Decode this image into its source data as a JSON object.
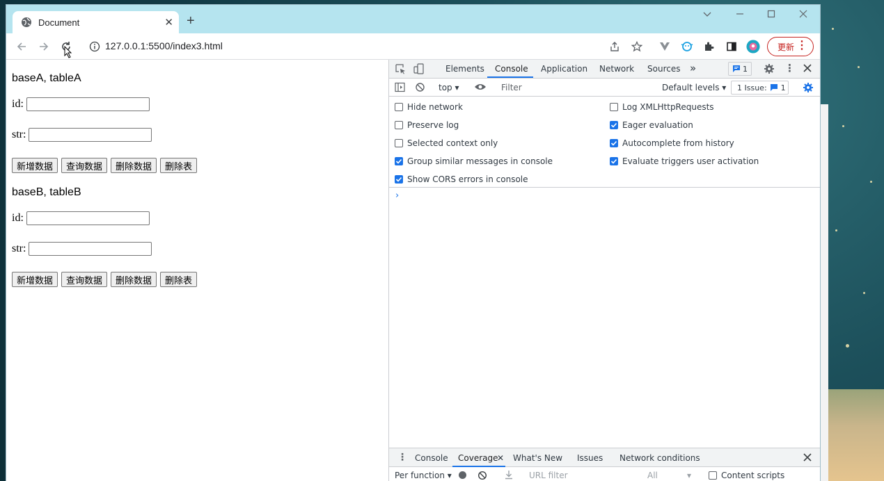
{
  "browser": {
    "tab_title": "Document",
    "url": "127.0.0.1:5500/index3.html",
    "update_label": "更新"
  },
  "page": {
    "sections": [
      {
        "heading": "baseA, tableA",
        "id_label": "id:",
        "str_label": "str:",
        "buttons": [
          "新增数据",
          "查询数据",
          "删除数据",
          "删除表"
        ]
      },
      {
        "heading": "baseB, tableB",
        "id_label": "id:",
        "str_label": "str:",
        "buttons": [
          "新增数据",
          "查询数据",
          "删除数据",
          "删除表"
        ]
      }
    ]
  },
  "devtools": {
    "tabs": [
      "Elements",
      "Console",
      "Application",
      "Network",
      "Sources"
    ],
    "active_tab": "Console",
    "messages_badge": "1",
    "toolbar": {
      "context": "top",
      "filter_placeholder": "Filter",
      "levels": "Default levels",
      "issues_label": "1 Issue:",
      "issues_count": "1"
    },
    "settings_left": [
      {
        "label": "Hide network",
        "checked": false
      },
      {
        "label": "Preserve log",
        "checked": false
      },
      {
        "label": "Selected context only",
        "checked": false
      },
      {
        "label": "Group similar messages in console",
        "checked": true
      },
      {
        "label": "Show CORS errors in console",
        "checked": true
      }
    ],
    "settings_right": [
      {
        "label": "Log XMLHttpRequests",
        "checked": false
      },
      {
        "label": "Eager evaluation",
        "checked": true
      },
      {
        "label": "Autocomplete from history",
        "checked": true
      },
      {
        "label": "Evaluate triggers user activation",
        "checked": true
      }
    ],
    "prompt": "›",
    "drawer_tabs": [
      "Console",
      "Coverage",
      "What's New",
      "Issues",
      "Network conditions"
    ],
    "drawer_active": "Coverage",
    "drawer_toolbar": {
      "mode": "Per function",
      "url_filter_placeholder": "URL filter",
      "type": "All",
      "content_scripts": "Content scripts"
    }
  },
  "colors": {
    "tabstrip": "#b5e4ef",
    "accent": "#1a73e8",
    "update": "#c5221f"
  }
}
